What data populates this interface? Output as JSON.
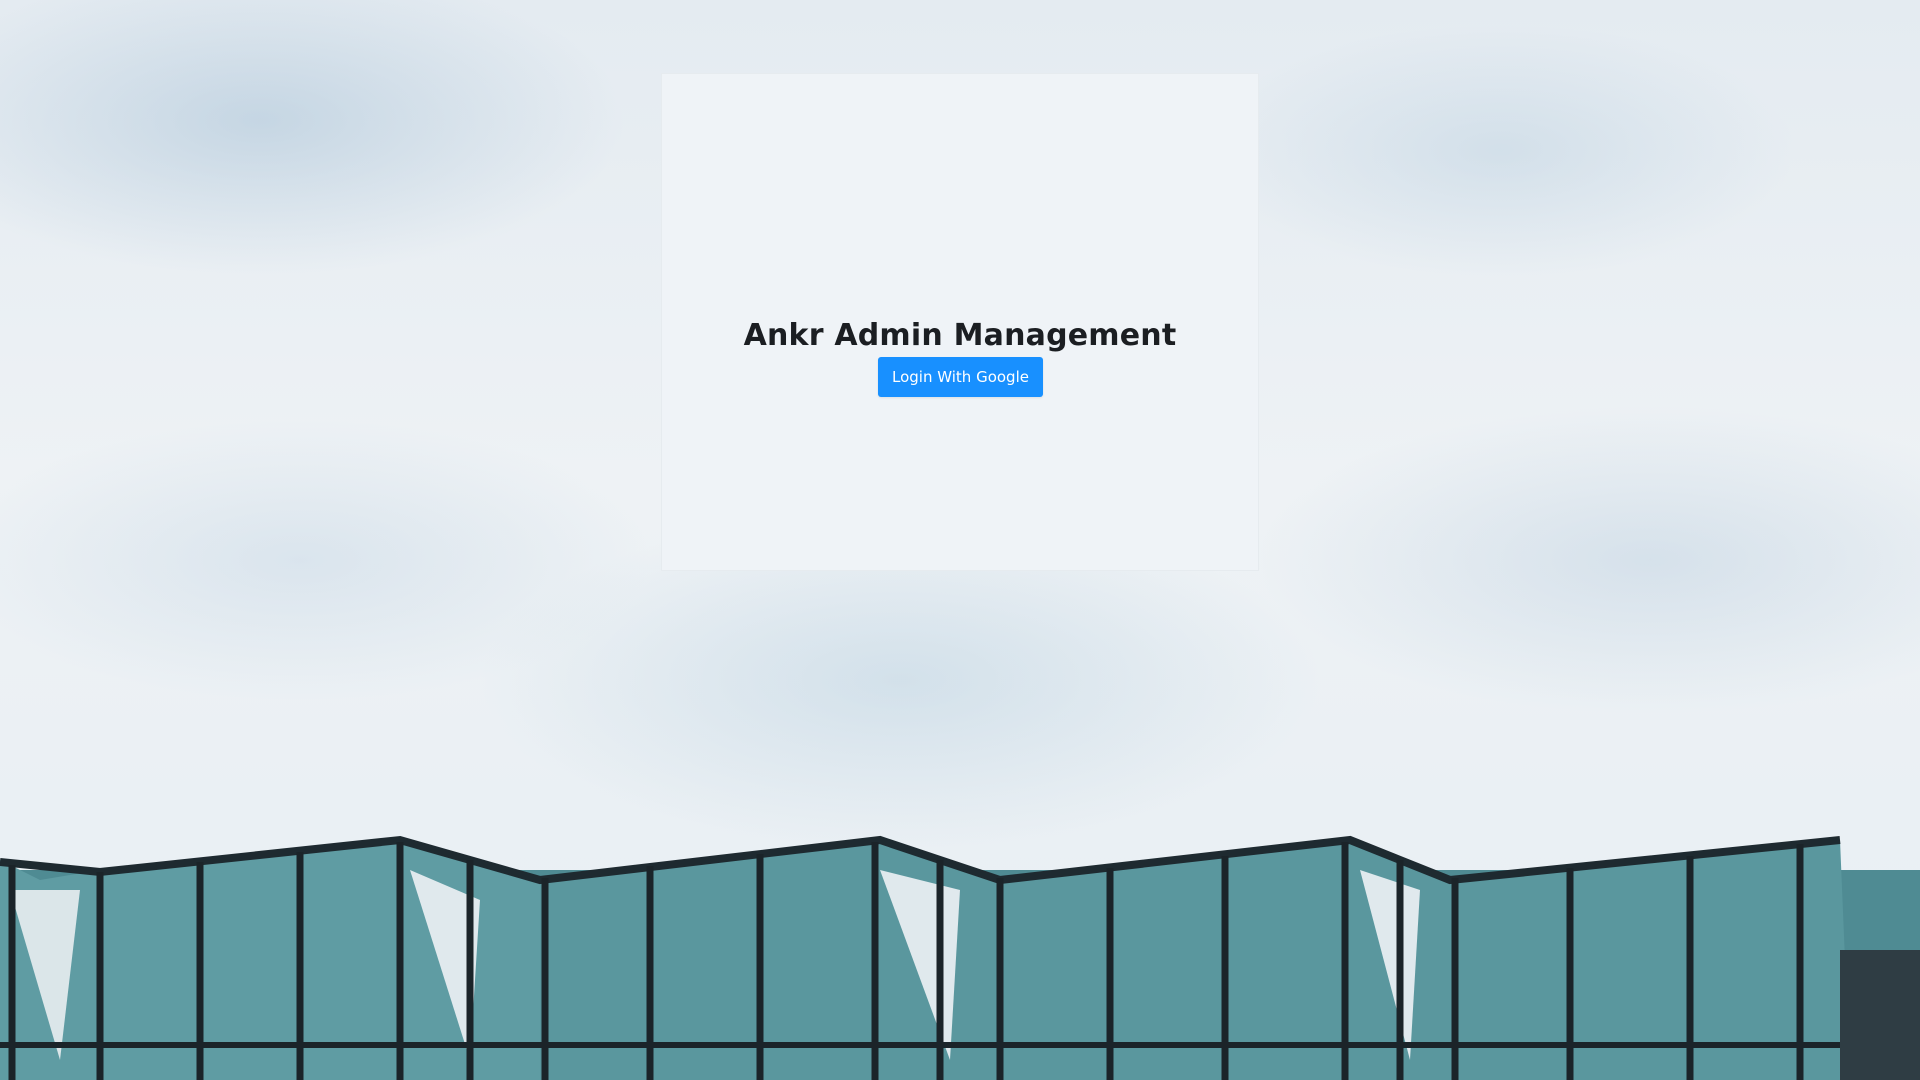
{
  "page": {
    "title": "Ankr Admin Management"
  },
  "login": {
    "button_label": "Login With Google",
    "accent_color": "#1890ff"
  },
  "background": {
    "description_icon": "sky-building-photo"
  }
}
